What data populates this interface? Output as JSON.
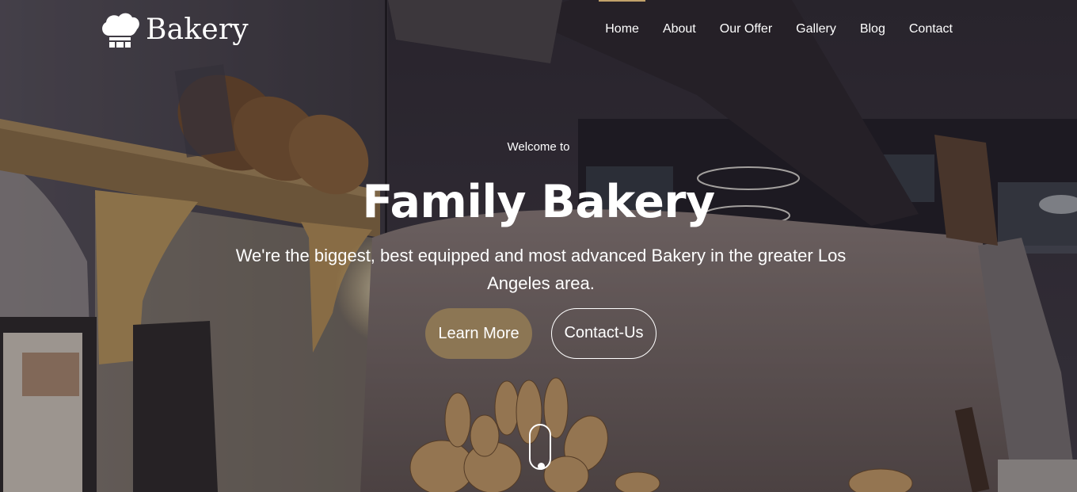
{
  "brand": {
    "name": "Bakery",
    "icon": "chef-hat-icon"
  },
  "nav": {
    "items": [
      {
        "label": "Home",
        "active": true
      },
      {
        "label": "About"
      },
      {
        "label": "Our Offer"
      },
      {
        "label": "Gallery"
      },
      {
        "label": "Blog"
      },
      {
        "label": "Contact"
      }
    ]
  },
  "hero": {
    "welcome": "Welcome to",
    "title": "Family Bakery",
    "subtitle": "We're the biggest, best equipped and most advanced Bakery in the greater Los Angeles area.",
    "primary_button": "Learn More",
    "secondary_button": "Contact-Us",
    "scroll_icon": "mouse-scroll-icon"
  },
  "colors": {
    "accent": "#c2a26a",
    "primary_button": "#8c7654",
    "text": "#ffffff"
  }
}
